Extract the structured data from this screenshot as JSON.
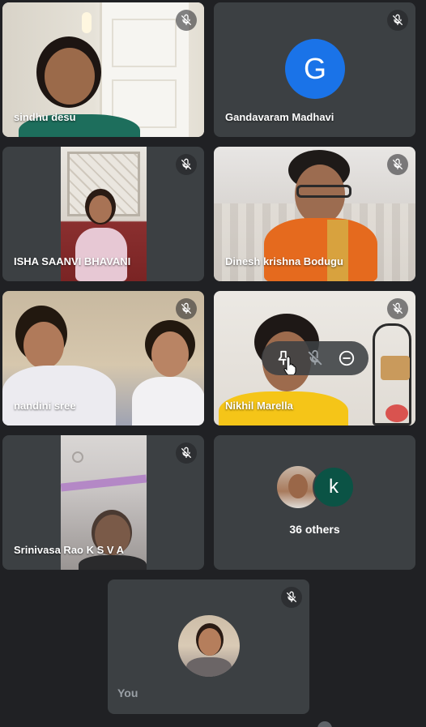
{
  "participants": [
    {
      "name": "sindhu desu",
      "muted": true
    },
    {
      "name": "Gandavaram Madhavi",
      "muted": true,
      "avatar_letter": "G",
      "avatar_color": "#1a73e8"
    },
    {
      "name": "ISHA SAANVI BHAVANI",
      "muted": true
    },
    {
      "name": "Dinesh krishna Bodugu",
      "muted": true
    },
    {
      "name": "nandini sree",
      "muted": true
    },
    {
      "name": "Nikhil Marella",
      "muted": true
    },
    {
      "name": "Srinivasa Rao K S V A",
      "muted": true
    }
  ],
  "others": {
    "label": "36 others",
    "avatar_letter": "k",
    "avatar_color": "#0b5345"
  },
  "self": {
    "label": "You",
    "muted": true
  },
  "hover_controls": {
    "pin": "pin-icon",
    "mute": "mic-off-icon",
    "remove": "remove-icon"
  },
  "colors": {
    "background": "#202124",
    "tile": "#3c4043",
    "text": "#ffffff"
  }
}
